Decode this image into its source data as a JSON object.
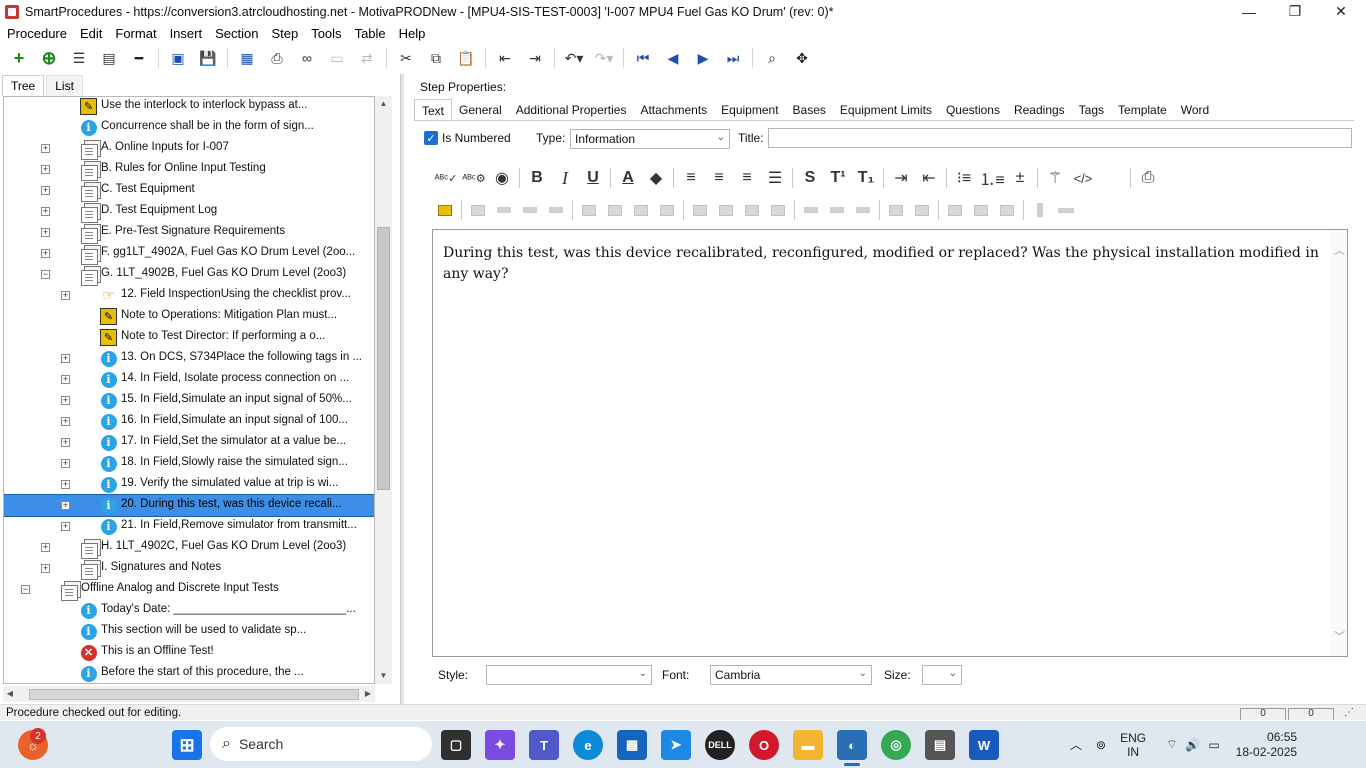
{
  "window": {
    "title": "SmartProcedures - https://conversion3.atrcloudhosting.net - MotivaPRODNew - [MPU4-SIS-TEST-0003] 'I-007 MPU4 Fuel Gas KO Drum' (rev: 0)*",
    "minimize": "—",
    "restore": "❐",
    "close": "✕"
  },
  "menu": [
    "Procedure",
    "Edit",
    "Format",
    "Insert",
    "Section",
    "Step",
    "Tools",
    "Table",
    "Help"
  ],
  "left_tabs": [
    "Tree",
    "List"
  ],
  "tree": [
    {
      "label": "Use the interlock to interlock bypass at...",
      "icon": "warn",
      "indent": 1,
      "expander": ""
    },
    {
      "label": "Concurrence shall be in the form of sign...",
      "icon": "info",
      "indent": 1,
      "expander": ""
    },
    {
      "label": "A. Online Inputs for I-007",
      "icon": "doc",
      "indent": 1,
      "expander": "+"
    },
    {
      "label": "B. Rules for Online Input Testing",
      "icon": "doc",
      "indent": 1,
      "expander": "+"
    },
    {
      "label": "C. Test Equipment",
      "icon": "doc",
      "indent": 1,
      "expander": "+"
    },
    {
      "label": "D. Test Equipment Log",
      "icon": "doc",
      "indent": 1,
      "expander": "+"
    },
    {
      "label": "E. Pre-Test Signature Requirements",
      "icon": "doc",
      "indent": 1,
      "expander": "+"
    },
    {
      "label": "F. gg1LT_4902A, Fuel Gas KO Drum Level (2oo...",
      "icon": "doc",
      "indent": 1,
      "expander": "+"
    },
    {
      "label": "G. 1LT_4902B, Fuel Gas KO Drum Level (2oo3)",
      "icon": "doc",
      "indent": 1,
      "expander": "−"
    },
    {
      "label": "12. Field InspectionUsing the checklist prov...",
      "icon": "hand",
      "indent": 2,
      "expander": "+"
    },
    {
      "label": "Note to Operations: Mitigation Plan must...",
      "icon": "warn",
      "indent": 2,
      "expander": ""
    },
    {
      "label": "Note to Test Director: If performing a o...",
      "icon": "warn",
      "indent": 2,
      "expander": ""
    },
    {
      "label": "13. On DCS, S734Place the following tags in ...",
      "icon": "info",
      "indent": 2,
      "expander": "+"
    },
    {
      "label": "14. In Field, Isolate process connection on ...",
      "icon": "info",
      "indent": 2,
      "expander": "+"
    },
    {
      "label": "15. In Field,Simulate an input signal of 50%...",
      "icon": "info",
      "indent": 2,
      "expander": "+"
    },
    {
      "label": "16. In Field,Simulate an input signal of 100...",
      "icon": "info",
      "indent": 2,
      "expander": "+"
    },
    {
      "label": "17. In Field,Set the simulator at a value be...",
      "icon": "info",
      "indent": 2,
      "expander": "+"
    },
    {
      "label": "18. In Field,Slowly raise the simulated sign...",
      "icon": "info",
      "indent": 2,
      "expander": "+"
    },
    {
      "label": "19. Verify the simulated value at trip is wi...",
      "icon": "info",
      "indent": 2,
      "expander": "+"
    },
    {
      "label": "20. During this test, was this device recali...",
      "icon": "info",
      "indent": 2,
      "expander": "+",
      "selected": true
    },
    {
      "label": "21. In Field,Remove simulator from transmitt...",
      "icon": "info",
      "indent": 2,
      "expander": "+"
    },
    {
      "label": "H. 1LT_4902C, Fuel Gas KO Drum Level (2oo3)",
      "icon": "doc",
      "indent": 1,
      "expander": "+"
    },
    {
      "label": "I. Signatures and Notes",
      "icon": "doc",
      "indent": 1,
      "expander": "+"
    },
    {
      "label": "Offline Analog and Discrete Input Tests",
      "icon": "doc",
      "indent": 0,
      "expander": "−"
    },
    {
      "label": "Today's Date: ___________________________...",
      "icon": "info",
      "indent": 1,
      "expander": ""
    },
    {
      "label": "This section will be used to validate sp...",
      "icon": "info",
      "indent": 1,
      "expander": ""
    },
    {
      "label": "This is an Offline Test!",
      "icon": "x",
      "indent": 1,
      "expander": ""
    },
    {
      "label": "Before the start of this procedure, the ...",
      "icon": "info",
      "indent": 1,
      "expander": ""
    }
  ],
  "step_properties": {
    "title": "Step Properties:",
    "tabs": [
      "Text",
      "General",
      "Additional Properties",
      "Attachments",
      "Equipment",
      "Bases",
      "Equipment Limits",
      "Questions",
      "Readings",
      "Tags",
      "Template",
      "Word"
    ],
    "is_numbered_label": "Is Numbered",
    "is_numbered": true,
    "type_label": "Type:",
    "type_value": "Information",
    "title_label": "Title:",
    "title_value": "",
    "text": "During this test, was this device recalibrated, reconfigured, modified or replaced? Was the physical installation modified in any way?",
    "style_label": "Style:",
    "style_value": "",
    "font_label": "Font:",
    "font_value": "Cambria",
    "size_label": "Size:",
    "size_value": ""
  },
  "status": {
    "text": "Procedure checked out for editing.",
    "panel1": "0",
    "panel2": "0"
  },
  "taskbar": {
    "search_label": "Search",
    "notification_count": "2",
    "lang_line1": "ENG",
    "lang_line2": "IN",
    "time": "06:55",
    "date": "18-02-2025"
  }
}
